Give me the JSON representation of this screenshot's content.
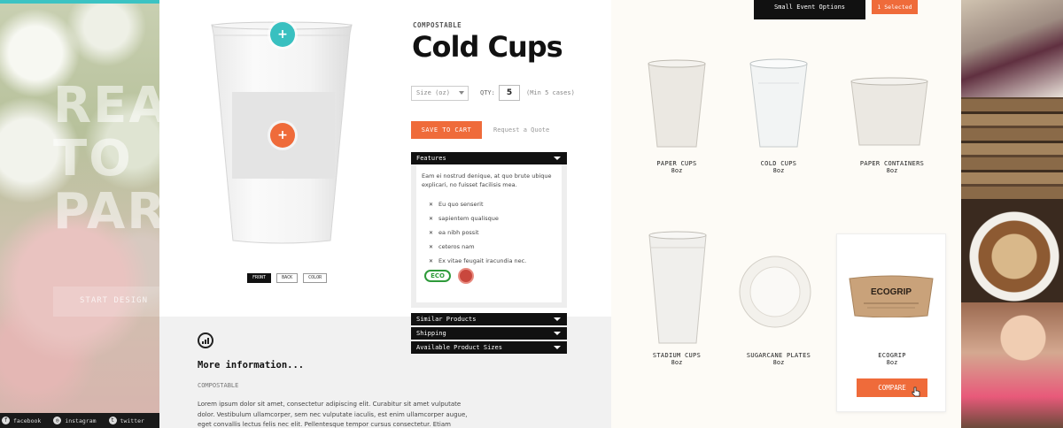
{
  "hero": {
    "headline_lines": [
      "REA",
      "TO",
      "PAR"
    ],
    "cta_label": "START DESIGN"
  },
  "social": [
    {
      "icon": "facebook-icon",
      "label": "facebook"
    },
    {
      "icon": "instagram-icon",
      "label": "instagram"
    },
    {
      "icon": "twitter-icon",
      "label": "twitter"
    }
  ],
  "product": {
    "category": "COMPOSTABLE",
    "title": "Cold Cups",
    "size_placeholder": "Size (oz)",
    "qty_label": "QTY:",
    "qty_value": "5",
    "qty_min": "(Min 5 cases)",
    "save_label": "SAVE TO CART",
    "quote_label": "Request a Quote",
    "view_buttons": [
      "FRONT",
      "BACK",
      "COLOR"
    ],
    "active_view": "FRONT"
  },
  "accordion": {
    "features_label": "Features",
    "features_text": "Eam ei nostrud denique, at quo brute ubique explicari, no fuisset facilisis mea.",
    "features_list": [
      "Eu quo senserit",
      "sapientem qualisque",
      "ea nibh possit",
      "ceteros nam",
      "Ex vitae feugait iracundia nec."
    ],
    "eco_badge": "ECO",
    "similar_label": "Similar Products",
    "shipping_label": "Shipping",
    "sizes_label": "Available Product Sizes"
  },
  "more_info": {
    "title": "More information...",
    "category": "COMPOSTABLE",
    "body": "Lorem ipsum dolor sit amet, consectetur adipiscing elit. Curabitur sit amet vulputate dolor. Vestibulum ullamcorper, sem nec vulputate iaculis, est enim ullamcorper augue, eget convallis lectus felis nec elit. Pellentesque tempor cursus consectetur. Etiam mattis ipsum at ipsum vestibulum tincidunt. Etiam"
  },
  "compare": {
    "event_label": "Small Event Options",
    "selected_label": "1 Selected",
    "items": [
      {
        "name": "PAPER CUPS",
        "size": "8oz"
      },
      {
        "name": "COLD CUPS",
        "size": "8oz"
      },
      {
        "name": "PAPER CONTAINERS",
        "size": "8oz"
      },
      {
        "name": "STADIUM CUPS",
        "size": "8oz"
      },
      {
        "name": "SUGARCANE PLATES",
        "size": "8oz"
      },
      {
        "name": "ECOGRIP",
        "size": "8oz"
      }
    ],
    "sleeve_brand": "ECOGRIP",
    "compare_label": "COMPARE"
  },
  "colors": {
    "accent_orange": "#ef6b3a",
    "accent_teal": "#39c0c0",
    "dark": "#111111"
  }
}
